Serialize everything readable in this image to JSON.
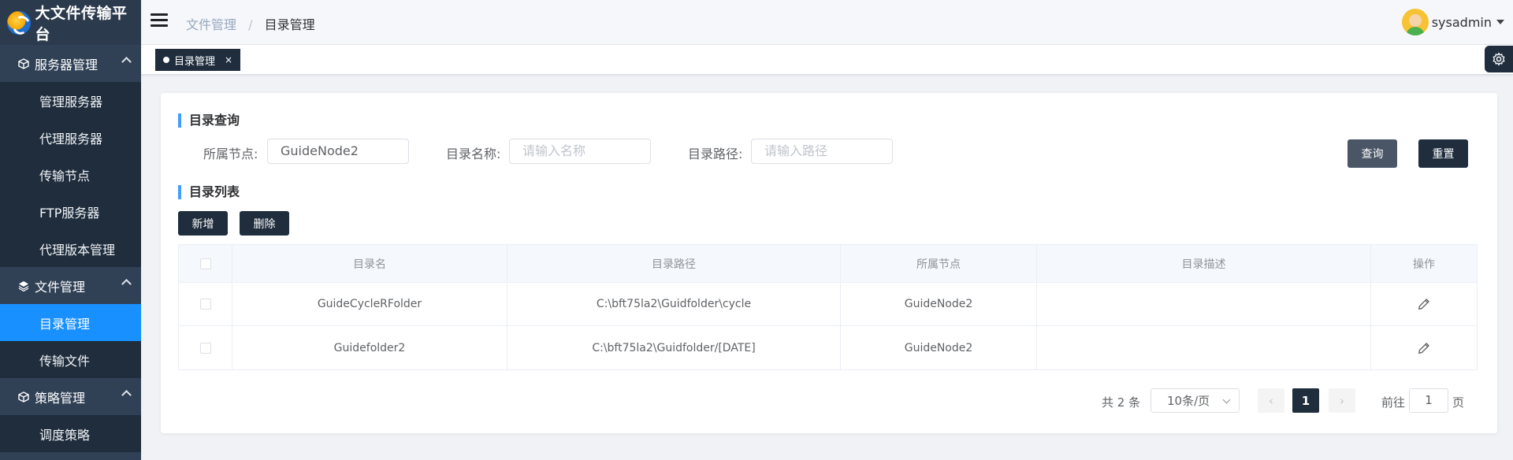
{
  "app": {
    "title": "大文件传输平台"
  },
  "sidebar": {
    "groups": [
      {
        "label": "服务器管理",
        "icon": "cube-icon",
        "items": [
          "管理服务器",
          "代理服务器",
          "传输节点",
          "FTP服务器",
          "代理版本管理"
        ]
      },
      {
        "label": "文件管理",
        "icon": "layers-icon",
        "items": [
          "目录管理",
          "传输文件"
        ]
      },
      {
        "label": "策略管理",
        "icon": "cube-icon",
        "items": [
          "调度策略"
        ]
      }
    ],
    "active_item": "目录管理"
  },
  "header": {
    "breadcrumb": [
      "文件管理",
      "目录管理"
    ],
    "separator": "/",
    "username": "sysadmin"
  },
  "tags": {
    "active_tag": "目录管理",
    "close_symbol": "×"
  },
  "query": {
    "title": "目录查询",
    "node_label": "所属节点:",
    "node_value": "GuideNode2",
    "name_label": "目录名称:",
    "name_placeholder": "请输入名称",
    "path_label": "目录路径:",
    "path_placeholder": "请输入路径",
    "search_button": "查询",
    "reset_button": "重置"
  },
  "list": {
    "title": "目录列表",
    "add_button": "新增",
    "delete_button": "删除",
    "columns": [
      "目录名",
      "目录路径",
      "所属节点",
      "目录描述",
      "操作"
    ],
    "rows": [
      {
        "name": "GuideCycleRFolder",
        "path": "C:\\bft75la2\\Guidfolder\\cycle",
        "node": "GuideNode2",
        "desc": ""
      },
      {
        "name": "Guidefolder2",
        "path": "C:\\bft75la2\\Guidfolder/[DATE]",
        "node": "GuideNode2",
        "desc": ""
      }
    ]
  },
  "pagination": {
    "total_text": "共 2 条",
    "page_size": "10条/页",
    "prev": "‹",
    "next": "›",
    "current_page": "1",
    "goto_label": "前往",
    "goto_value": "1",
    "goto_suffix": "页"
  },
  "colors": {
    "sidebar_bg": "#304156",
    "active": "#1890ff",
    "accent": "#409eff",
    "dark_button": "#1f2d3d"
  }
}
